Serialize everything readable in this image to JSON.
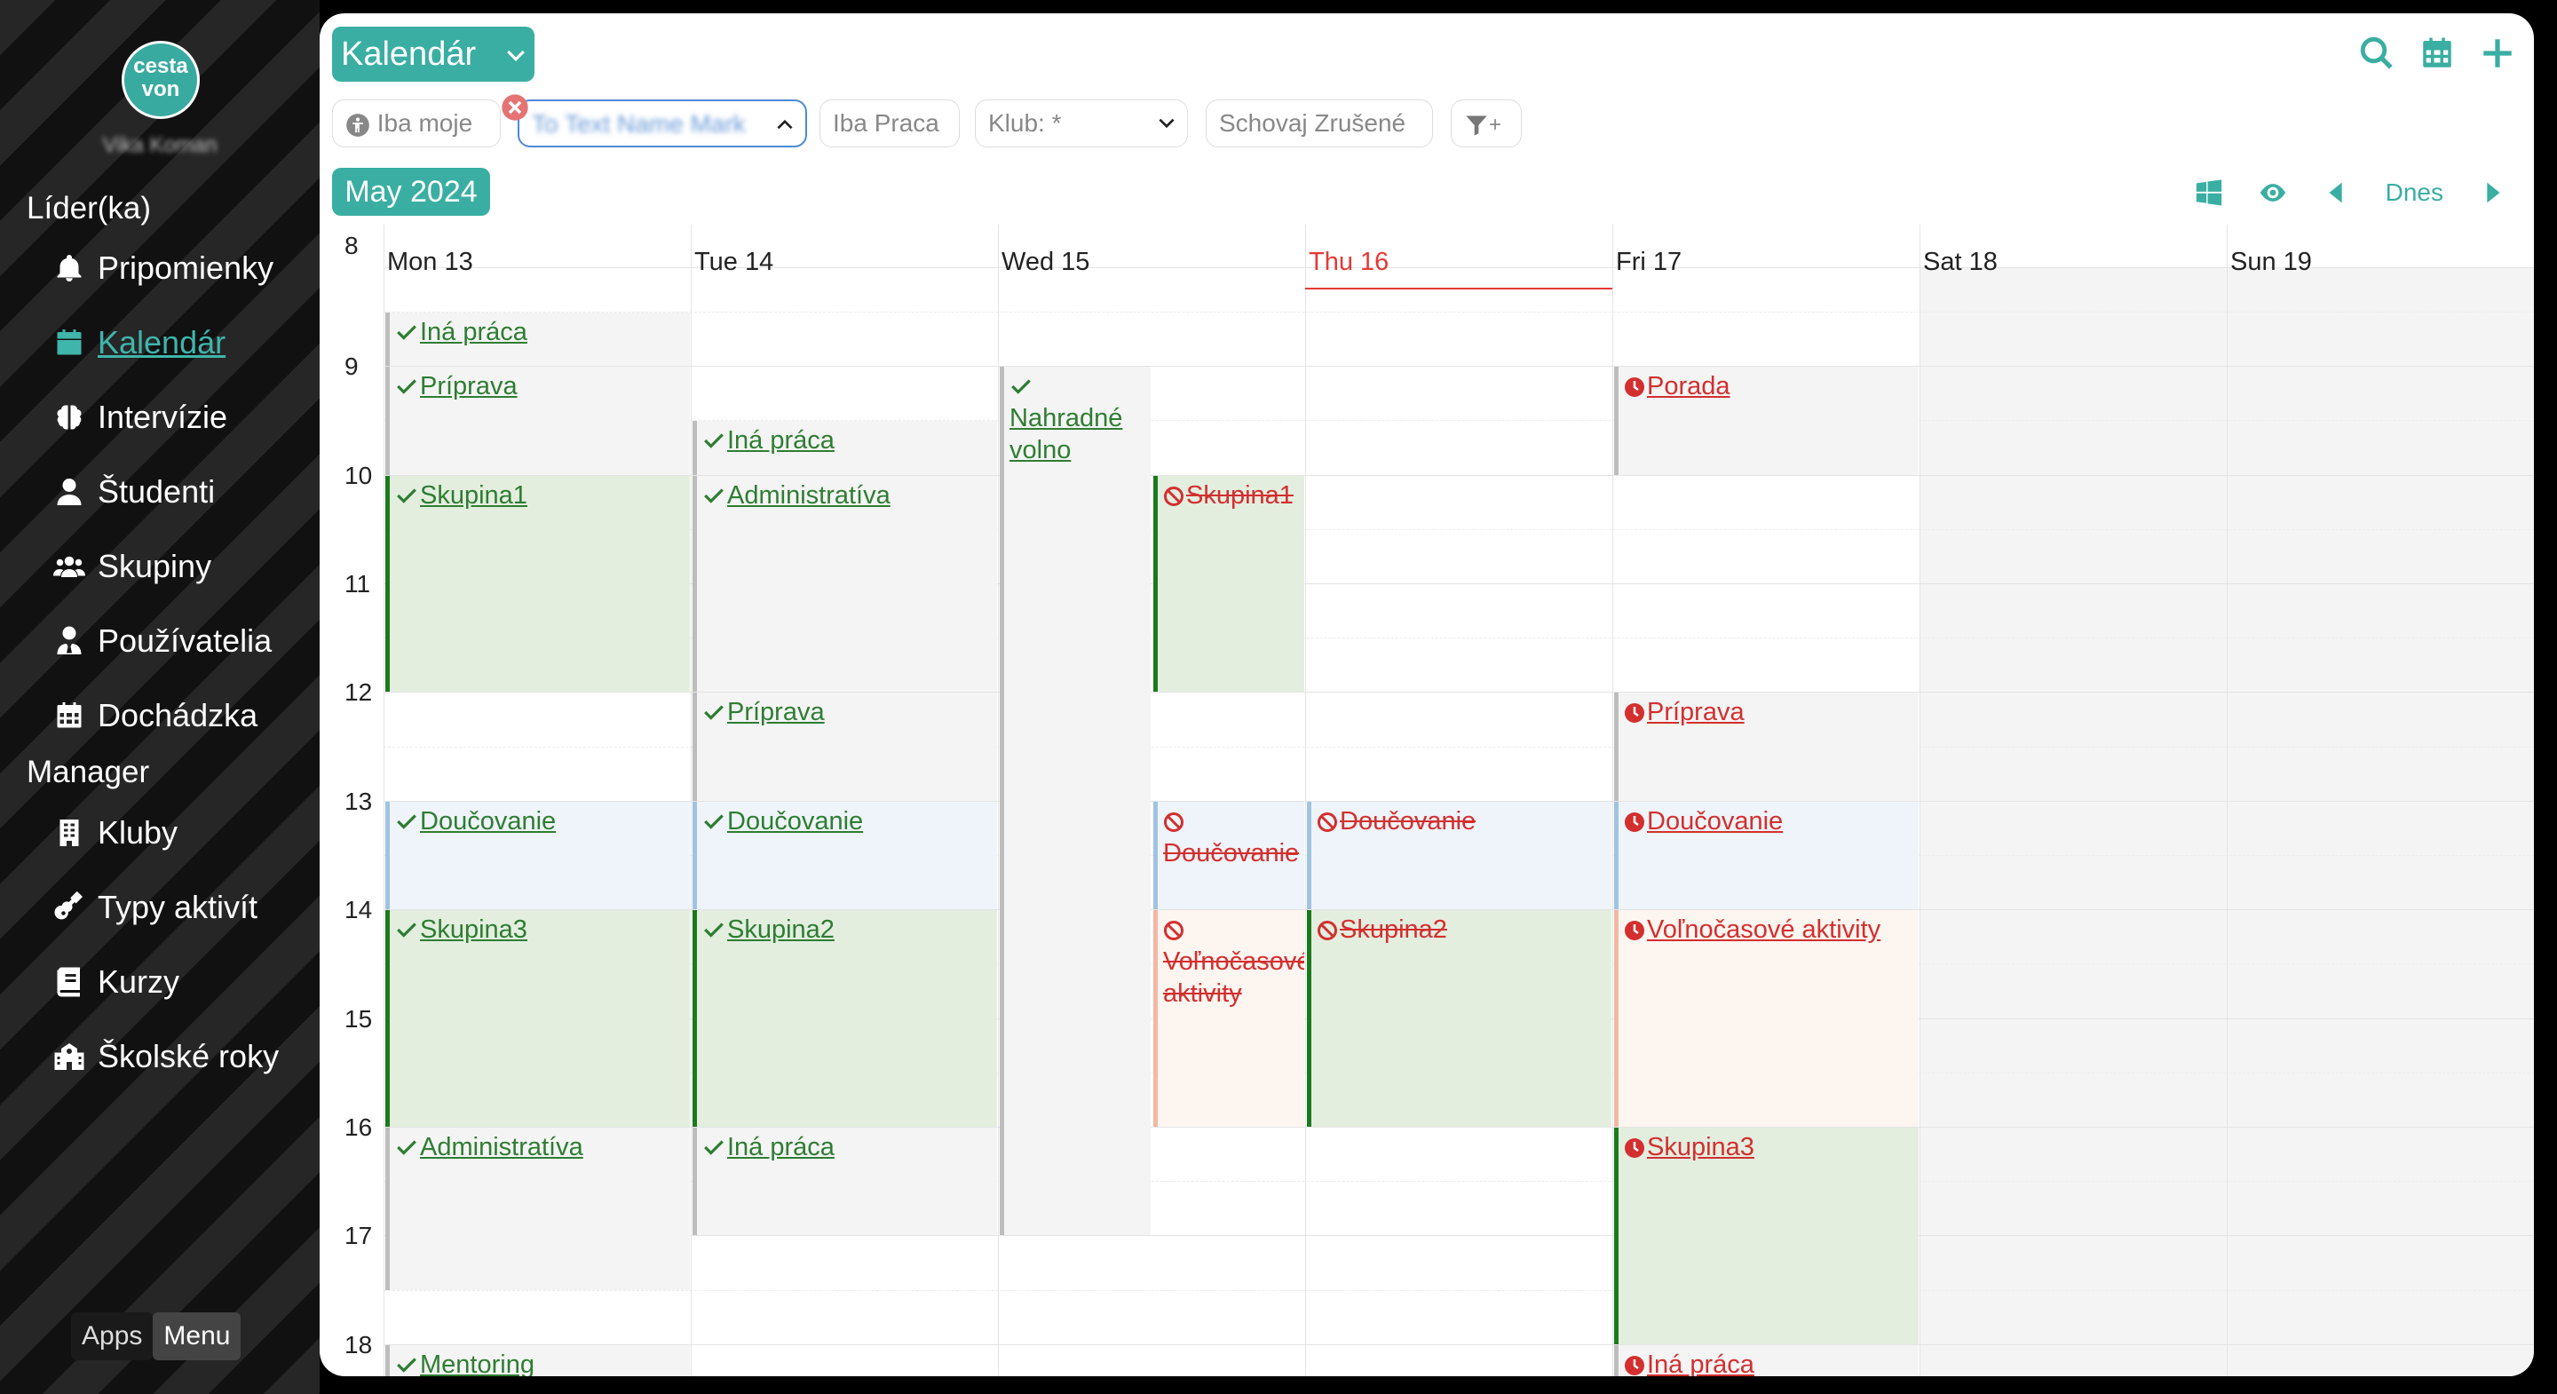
{
  "sidebar": {
    "logo_line1": "cesta",
    "logo_line2": "von",
    "username": "Vika Koman",
    "section_leader": "Líder(ka)",
    "section_manager": "Manager",
    "items": [
      {
        "label": "Pripomienky",
        "icon": "bell-icon"
      },
      {
        "label": "Kalendár",
        "icon": "calendar-icon",
        "active": true
      },
      {
        "label": "Intervízie",
        "icon": "brain-icon"
      },
      {
        "label": "Študenti",
        "icon": "user-icon"
      },
      {
        "label": "Skupiny",
        "icon": "users-icon"
      },
      {
        "label": "Používatelia",
        "icon": "user-tie-icon"
      },
      {
        "label": "Dochádzka",
        "icon": "calendar-grid-icon"
      },
      {
        "label": "Kluby",
        "icon": "building-icon"
      },
      {
        "label": "Typy aktivít",
        "icon": "guitar-icon"
      },
      {
        "label": "Kurzy",
        "icon": "book-icon"
      },
      {
        "label": "Školské roky",
        "icon": "school-icon"
      }
    ],
    "apps_label": "Apps",
    "menu_label": "Menu"
  },
  "header": {
    "title": "Kalendár",
    "filters": {
      "only_mine": "Iba moje",
      "selected_user": "To Text Name Mark",
      "only_work": "Iba Praca",
      "club": "Klub: *",
      "hide_cancelled": "Schovaj Zrušené",
      "filter_plus": "+"
    },
    "month": "May 2024",
    "today_label": "Dnes"
  },
  "calendar": {
    "hours": [
      "8",
      "9",
      "10",
      "11",
      "12",
      "13",
      "14",
      "15",
      "16",
      "17",
      "18"
    ],
    "days": [
      "Mon 13",
      "Tue 14",
      "Wed 15",
      "Thu 16",
      "Fri 17",
      "Sat 18",
      "Sun 19"
    ],
    "today_index": 3,
    "events": [
      {
        "day": 0,
        "col": 0,
        "cols": 1,
        "start": 8.5,
        "end": 9.0,
        "title": "Iná práca",
        "status": "done",
        "kind": "gray"
      },
      {
        "day": 0,
        "col": 0,
        "cols": 1,
        "start": 9.0,
        "end": 10.0,
        "title": "Príprava",
        "status": "done",
        "kind": "gray"
      },
      {
        "day": 0,
        "col": 0,
        "cols": 1,
        "start": 10.0,
        "end": 12.0,
        "title": "Skupina1",
        "status": "done",
        "kind": "green"
      },
      {
        "day": 0,
        "col": 0,
        "cols": 1,
        "start": 13.0,
        "end": 14.0,
        "title": "Doučovanie",
        "status": "done",
        "kind": "blue"
      },
      {
        "day": 0,
        "col": 0,
        "cols": 1,
        "start": 14.0,
        "end": 16.0,
        "title": "Skupina3",
        "status": "done",
        "kind": "green"
      },
      {
        "day": 0,
        "col": 0,
        "cols": 1,
        "start": 16.0,
        "end": 17.5,
        "title": "Administratíva",
        "status": "done",
        "kind": "gray"
      },
      {
        "day": 0,
        "col": 0,
        "cols": 1,
        "start": 18.0,
        "end": 18.5,
        "title": "Mentoring",
        "status": "done",
        "kind": "gray"
      },
      {
        "day": 1,
        "col": 0,
        "cols": 1,
        "start": 9.5,
        "end": 10.0,
        "title": "Iná práca",
        "status": "done",
        "kind": "gray"
      },
      {
        "day": 1,
        "col": 0,
        "cols": 1,
        "start": 10.0,
        "end": 12.0,
        "title": "Administratíva",
        "status": "done",
        "kind": "gray"
      },
      {
        "day": 1,
        "col": 0,
        "cols": 1,
        "start": 12.0,
        "end": 13.0,
        "title": "Príprava",
        "status": "done",
        "kind": "gray"
      },
      {
        "day": 1,
        "col": 0,
        "cols": 1,
        "start": 13.0,
        "end": 14.0,
        "title": "Doučovanie",
        "status": "done",
        "kind": "blue"
      },
      {
        "day": 1,
        "col": 0,
        "cols": 1,
        "start": 14.0,
        "end": 16.0,
        "title": "Skupina2",
        "status": "done",
        "kind": "green"
      },
      {
        "day": 1,
        "col": 0,
        "cols": 1,
        "start": 16.0,
        "end": 17.0,
        "title": "Iná práca",
        "status": "done",
        "kind": "gray"
      },
      {
        "day": 2,
        "col": 0,
        "cols": 2,
        "start": 9.0,
        "end": 17.0,
        "title": "Nahradné volno",
        "status": "done",
        "kind": "gray",
        "wrap": true
      },
      {
        "day": 2,
        "col": 1,
        "cols": 2,
        "start": 10.0,
        "end": 12.0,
        "title": "Skupina1",
        "status": "cancelled",
        "kind": "green"
      },
      {
        "day": 2,
        "col": 1,
        "cols": 2,
        "start": 13.0,
        "end": 14.0,
        "title": "Doučovanie",
        "status": "cancelled",
        "kind": "blue",
        "wrap": true
      },
      {
        "day": 2,
        "col": 1,
        "cols": 2,
        "start": 14.0,
        "end": 16.0,
        "title": "Voľnočasové aktivity",
        "status": "cancelled",
        "kind": "orange",
        "wrap": true
      },
      {
        "day": 3,
        "col": 0,
        "cols": 1,
        "start": 13.0,
        "end": 14.0,
        "title": "Doučovanie",
        "status": "cancelled",
        "kind": "blue"
      },
      {
        "day": 3,
        "col": 0,
        "cols": 1,
        "start": 14.0,
        "end": 16.0,
        "title": "Skupina2",
        "status": "cancelled",
        "kind": "green"
      },
      {
        "day": 4,
        "col": 0,
        "cols": 1,
        "start": 9.0,
        "end": 10.0,
        "title": "Porada",
        "status": "pending",
        "kind": "gray"
      },
      {
        "day": 4,
        "col": 0,
        "cols": 1,
        "start": 12.0,
        "end": 13.0,
        "title": "Príprava",
        "status": "pending",
        "kind": "gray"
      },
      {
        "day": 4,
        "col": 0,
        "cols": 1,
        "start": 13.0,
        "end": 14.0,
        "title": "Doučovanie",
        "status": "pending",
        "kind": "blue"
      },
      {
        "day": 4,
        "col": 0,
        "cols": 1,
        "start": 14.0,
        "end": 16.0,
        "title": "Voľnočasové aktivity",
        "status": "pending",
        "kind": "orange"
      },
      {
        "day": 4,
        "col": 0,
        "cols": 1,
        "start": 16.0,
        "end": 18.0,
        "title": "Skupina3",
        "status": "pending",
        "kind": "green"
      },
      {
        "day": 4,
        "col": 0,
        "cols": 1,
        "start": 18.0,
        "end": 18.5,
        "title": "Iná práca",
        "status": "pending",
        "kind": "gray"
      }
    ]
  },
  "colors": {
    "accent": "#3aaea2",
    "green_bg": "#e3eedf",
    "green_bar": "#1b7a1b",
    "gray_bg": "#f4f4f4",
    "gray_bar": "#bdbdbd",
    "blue_bg": "#eef4f9",
    "blue_bar": "#9fc3e0",
    "orange_bg": "#fdf5f0",
    "orange_bar": "#f2b8a4",
    "done_text": "#2e7d32",
    "cancel_text": "#d32f2f",
    "today": "#e53935"
  }
}
